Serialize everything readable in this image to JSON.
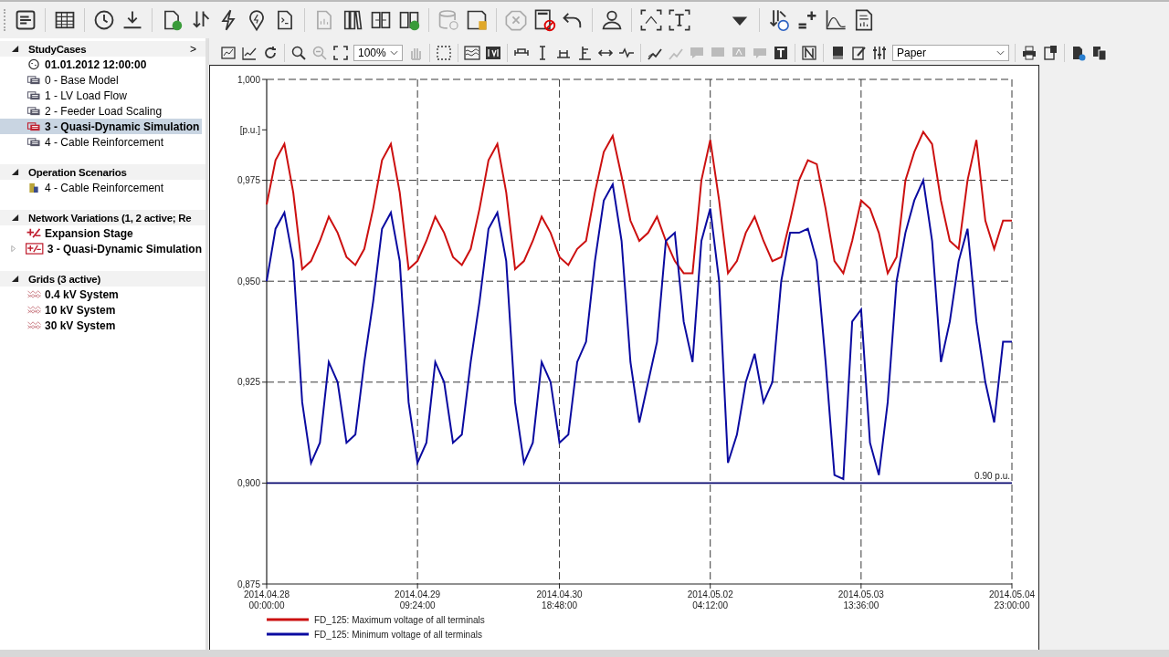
{
  "tree": {
    "sections": [
      {
        "title": "StudyCases",
        "expanded": true,
        "more": ">",
        "items": [
          {
            "label": "01.01.2012 12:00:00",
            "kind": "time",
            "active": true,
            "selected": false
          },
          {
            "label": "0 - Base Model",
            "kind": "case",
            "active": false,
            "selected": false
          },
          {
            "label": "1 - LV Load Flow",
            "kind": "case",
            "active": false,
            "selected": false
          },
          {
            "label": "2 - Feeder Load Scaling",
            "kind": "case",
            "active": false,
            "selected": false
          },
          {
            "label": "3 - Quasi-Dynamic Simulation",
            "kind": "case",
            "active": true,
            "selected": true
          },
          {
            "label": "4 - Cable Reinforcement",
            "kind": "case",
            "active": false,
            "selected": false
          }
        ]
      },
      {
        "title": "Operation Scenarios",
        "expanded": true,
        "items": [
          {
            "label": "4 - Cable Reinforcement",
            "kind": "scenario",
            "active": false,
            "selected": false
          }
        ]
      },
      {
        "title": "Network Variations (1, 2 active; Re",
        "expanded": true,
        "items": [
          {
            "label": "Expansion Stage",
            "kind": "stage",
            "active": true,
            "selected": false
          },
          {
            "label": "3 - Quasi-Dynamic Simulation",
            "kind": "variation",
            "active": true,
            "selected": false,
            "expanded": false
          }
        ]
      },
      {
        "title": "Grids (3 active)",
        "expanded": true,
        "items": [
          {
            "label": "0.4 kV System",
            "kind": "grid",
            "active": true,
            "selected": false
          },
          {
            "label": "10 kV System",
            "kind": "grid",
            "active": true,
            "selected": false
          },
          {
            "label": "30 kV System",
            "kind": "grid",
            "active": true,
            "selected": false
          }
        ]
      }
    ]
  },
  "chart_toolbar": {
    "zoom": "100%",
    "style": "Paper"
  },
  "plot": {
    "chart_data": {
      "type": "line",
      "grid": true,
      "legend": "bottom",
      "ylabel": "[p.u.]",
      "ylim": [
        0.875,
        1.0
      ],
      "yticks": [
        {
          "value": 0.875,
          "label": "0,875"
        },
        {
          "value": 0.9,
          "label": "0,900"
        },
        {
          "value": 0.925,
          "label": "0,925"
        },
        {
          "value": 0.95,
          "label": "0,950"
        },
        {
          "value": 0.975,
          "label": "0,975"
        },
        {
          "value": 1.0,
          "label": "1,000"
        }
      ],
      "categories": [
        "2014.04.28 00:00:00",
        null,
        null,
        null,
        null,
        null,
        null,
        null,
        null,
        null,
        null,
        null,
        null,
        null,
        null,
        null,
        null,
        "2014.04.29 09:24:00",
        null,
        null,
        null,
        null,
        null,
        null,
        null,
        null,
        null,
        null,
        null,
        null,
        null,
        null,
        null,
        "2014.04.30 18:48:00",
        null,
        null,
        null,
        null,
        null,
        null,
        null,
        null,
        null,
        null,
        null,
        null,
        null,
        null,
        null,
        null,
        "2014.05.02 04:12:00",
        null,
        null,
        null,
        null,
        null,
        null,
        null,
        null,
        null,
        null,
        null,
        null,
        null,
        null,
        null,
        null,
        "2014.05.03 13:36:00",
        null,
        null,
        null,
        null,
        null,
        null,
        null,
        null,
        null,
        null,
        null,
        null,
        null,
        null,
        null,
        null,
        "2014.05.04 23:00:00"
      ],
      "series": [
        {
          "name": "FD_125: Maximum voltage of all terminals",
          "color": "#cc1010",
          "values": [
            0.969,
            0.98,
            0.984,
            0.972,
            0.953,
            0.955,
            0.96,
            0.966,
            0.962,
            0.956,
            0.954,
            0.958,
            0.968,
            0.98,
            0.984,
            0.972,
            0.953,
            0.955,
            0.96,
            0.966,
            0.962,
            0.956,
            0.954,
            0.958,
            0.968,
            0.98,
            0.984,
            0.972,
            0.953,
            0.955,
            0.96,
            0.966,
            0.962,
            0.956,
            0.954,
            0.958,
            0.96,
            0.972,
            0.982,
            0.986,
            0.976,
            0.965,
            0.96,
            0.962,
            0.966,
            0.96,
            0.955,
            0.952,
            0.952,
            0.975,
            0.985,
            0.97,
            0.952,
            0.955,
            0.962,
            0.966,
            0.96,
            0.955,
            0.956,
            0.965,
            0.975,
            0.98,
            0.979,
            0.968,
            0.955,
            0.952,
            0.96,
            0.97,
            0.968,
            0.962,
            0.952,
            0.956,
            0.975,
            0.982,
            0.987,
            0.984,
            0.97,
            0.96,
            0.958,
            0.975,
            0.985,
            0.965,
            0.958,
            0.965,
            0.965
          ]
        },
        {
          "name": "FD_125: Minimum voltage of all terminals",
          "color": "#0a0aa0",
          "values": [
            0.95,
            0.963,
            0.967,
            0.955,
            0.92,
            0.905,
            0.91,
            0.93,
            0.925,
            0.91,
            0.912,
            0.93,
            0.945,
            0.963,
            0.967,
            0.955,
            0.92,
            0.905,
            0.91,
            0.93,
            0.925,
            0.91,
            0.912,
            0.93,
            0.945,
            0.963,
            0.967,
            0.955,
            0.92,
            0.905,
            0.91,
            0.93,
            0.925,
            0.91,
            0.912,
            0.93,
            0.935,
            0.955,
            0.97,
            0.974,
            0.96,
            0.93,
            0.915,
            0.925,
            0.935,
            0.96,
            0.962,
            0.94,
            0.93,
            0.96,
            0.968,
            0.95,
            0.905,
            0.912,
            0.925,
            0.932,
            0.92,
            0.925,
            0.95,
            0.962,
            0.962,
            0.963,
            0.955,
            0.93,
            0.902,
            0.901,
            0.94,
            0.943,
            0.91,
            0.902,
            0.92,
            0.95,
            0.962,
            0.97,
            0.975,
            0.96,
            0.93,
            0.94,
            0.955,
            0.963,
            0.94,
            0.925,
            0.915,
            0.935,
            0.935
          ]
        }
      ],
      "ref_lines": [
        {
          "axis": "y",
          "value": 0.9,
          "label": "0.90 p.u.",
          "color": "#0a0a70"
        }
      ]
    }
  }
}
